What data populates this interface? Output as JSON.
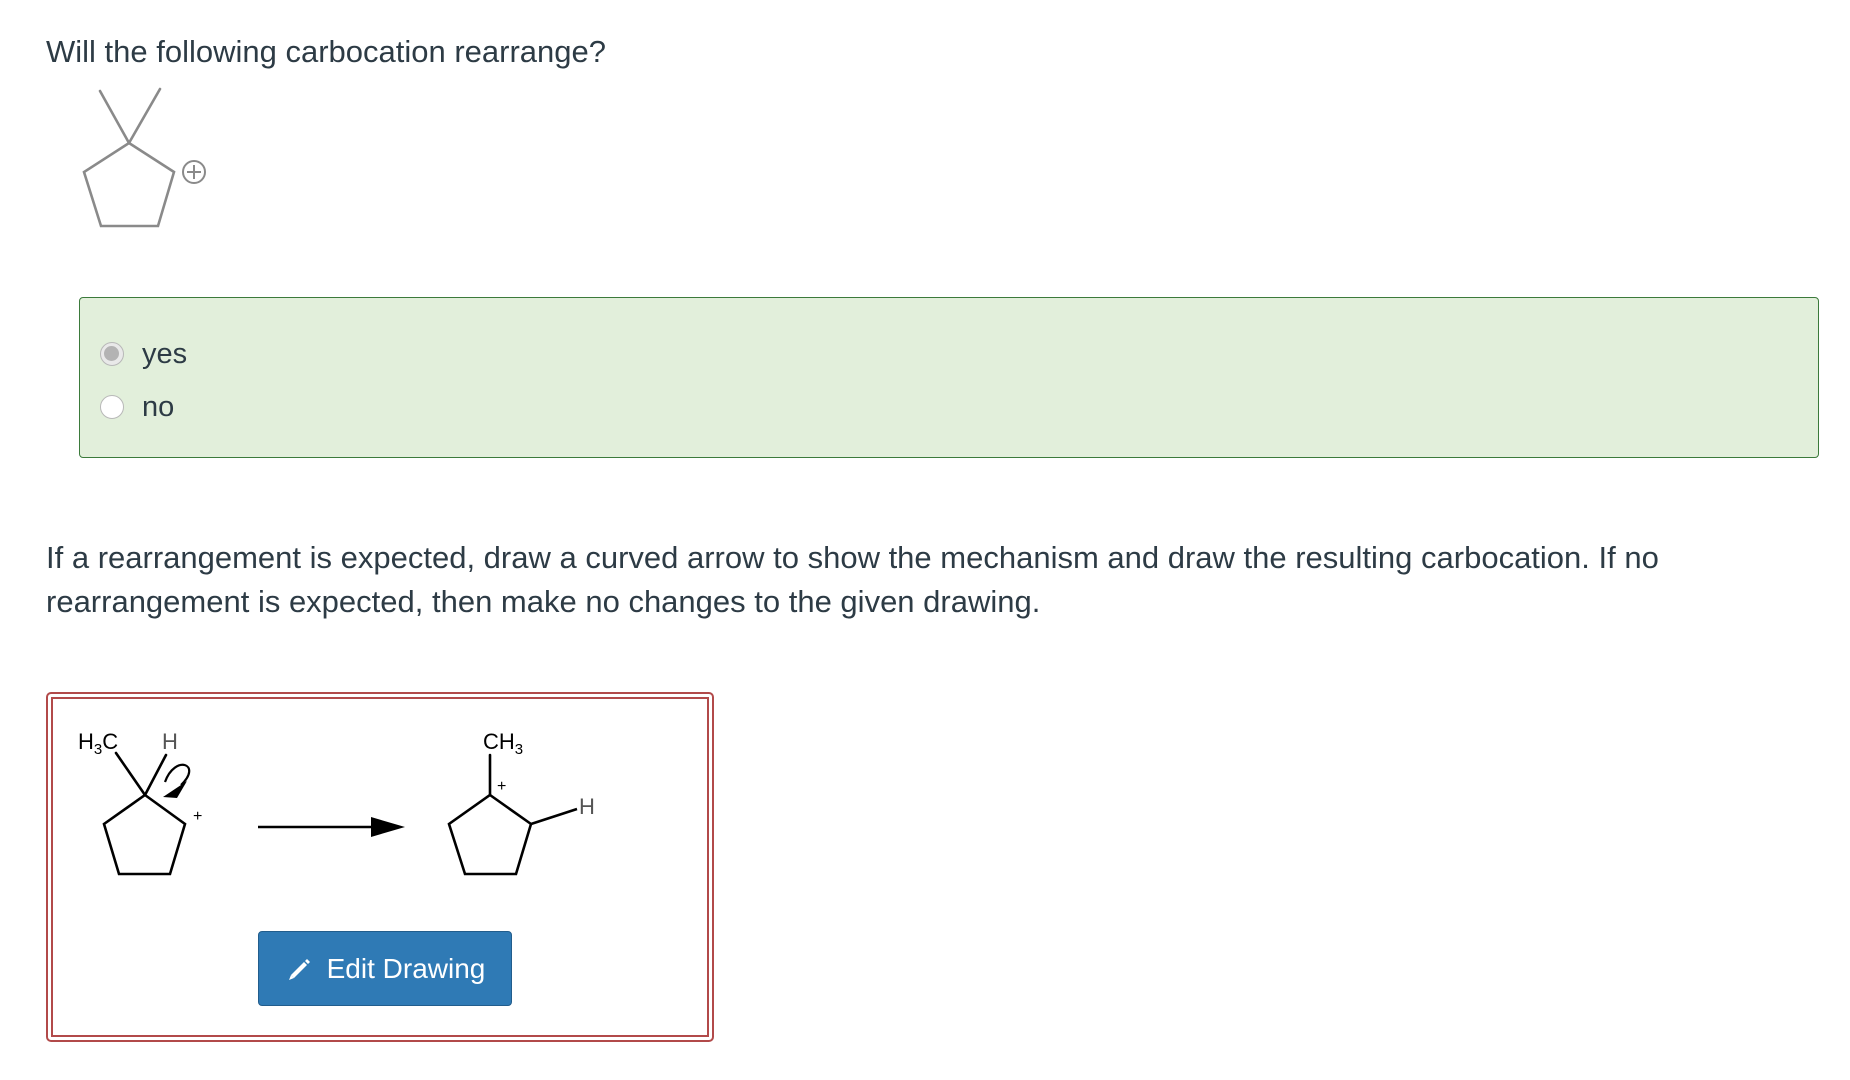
{
  "question": {
    "text": "Will the following carbocation rearrange?"
  },
  "answers": {
    "options": [
      {
        "label": "yes",
        "selected": true
      },
      {
        "label": "no",
        "selected": false
      }
    ],
    "box_color": "#e2efdb",
    "border_color": "#3b7a3b"
  },
  "instructions": {
    "text": "If a rearrangement is expected, draw a curved arrow to show the mechanism and draw the resulting carbocation. If no rearrangement is expected, then make no changes to the given drawing."
  },
  "drawing": {
    "reactant_labels": {
      "methyl": "H3C",
      "hydrogen": "H",
      "charge": "+"
    },
    "product_labels": {
      "methyl": "CH3",
      "hydrogen": "H",
      "charge": "+"
    },
    "edit_button_label": "Edit Drawing",
    "edit_icon": "pencil-icon",
    "frame_color": "#b24a4a",
    "button_color": "#2f7ab5"
  }
}
